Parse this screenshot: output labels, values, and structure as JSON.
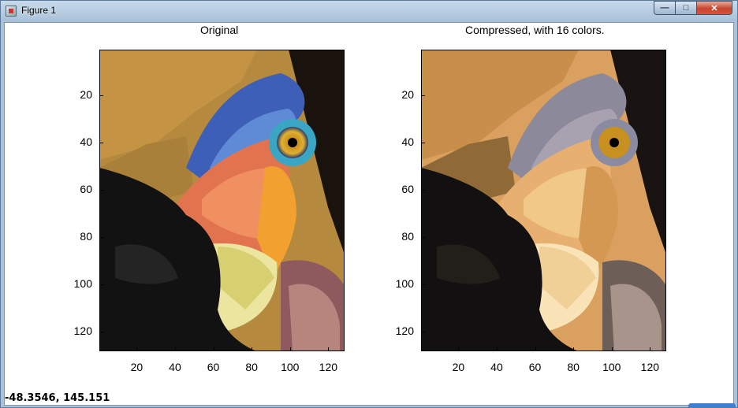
{
  "window": {
    "title": "Figure 1",
    "controls": {
      "minimize_glyph": "—",
      "maximize_glyph": "□",
      "close_glyph": "✕"
    }
  },
  "figures": [
    {
      "id": "original",
      "title": "Original",
      "y_ticks": [
        "20",
        "40",
        "60",
        "80",
        "100",
        "120"
      ],
      "x_ticks": [
        "20",
        "40",
        "60",
        "80",
        "100",
        "120"
      ],
      "image_desc_icon": "bird-photo-original"
    },
    {
      "id": "compressed",
      "title": "Compressed, with 16 colors.",
      "y_ticks": [
        "20",
        "40",
        "60",
        "80",
        "100",
        "120"
      ],
      "x_ticks": [
        "20",
        "40",
        "60",
        "80",
        "100",
        "120"
      ],
      "image_desc_icon": "bird-photo-compressed"
    }
  ],
  "status": {
    "coordinates": "-48.3546,  145.151"
  },
  "colors": {
    "window_frame": "#a9c2d9",
    "close_button": "#c7462f",
    "plot_background": "#ffffff"
  }
}
